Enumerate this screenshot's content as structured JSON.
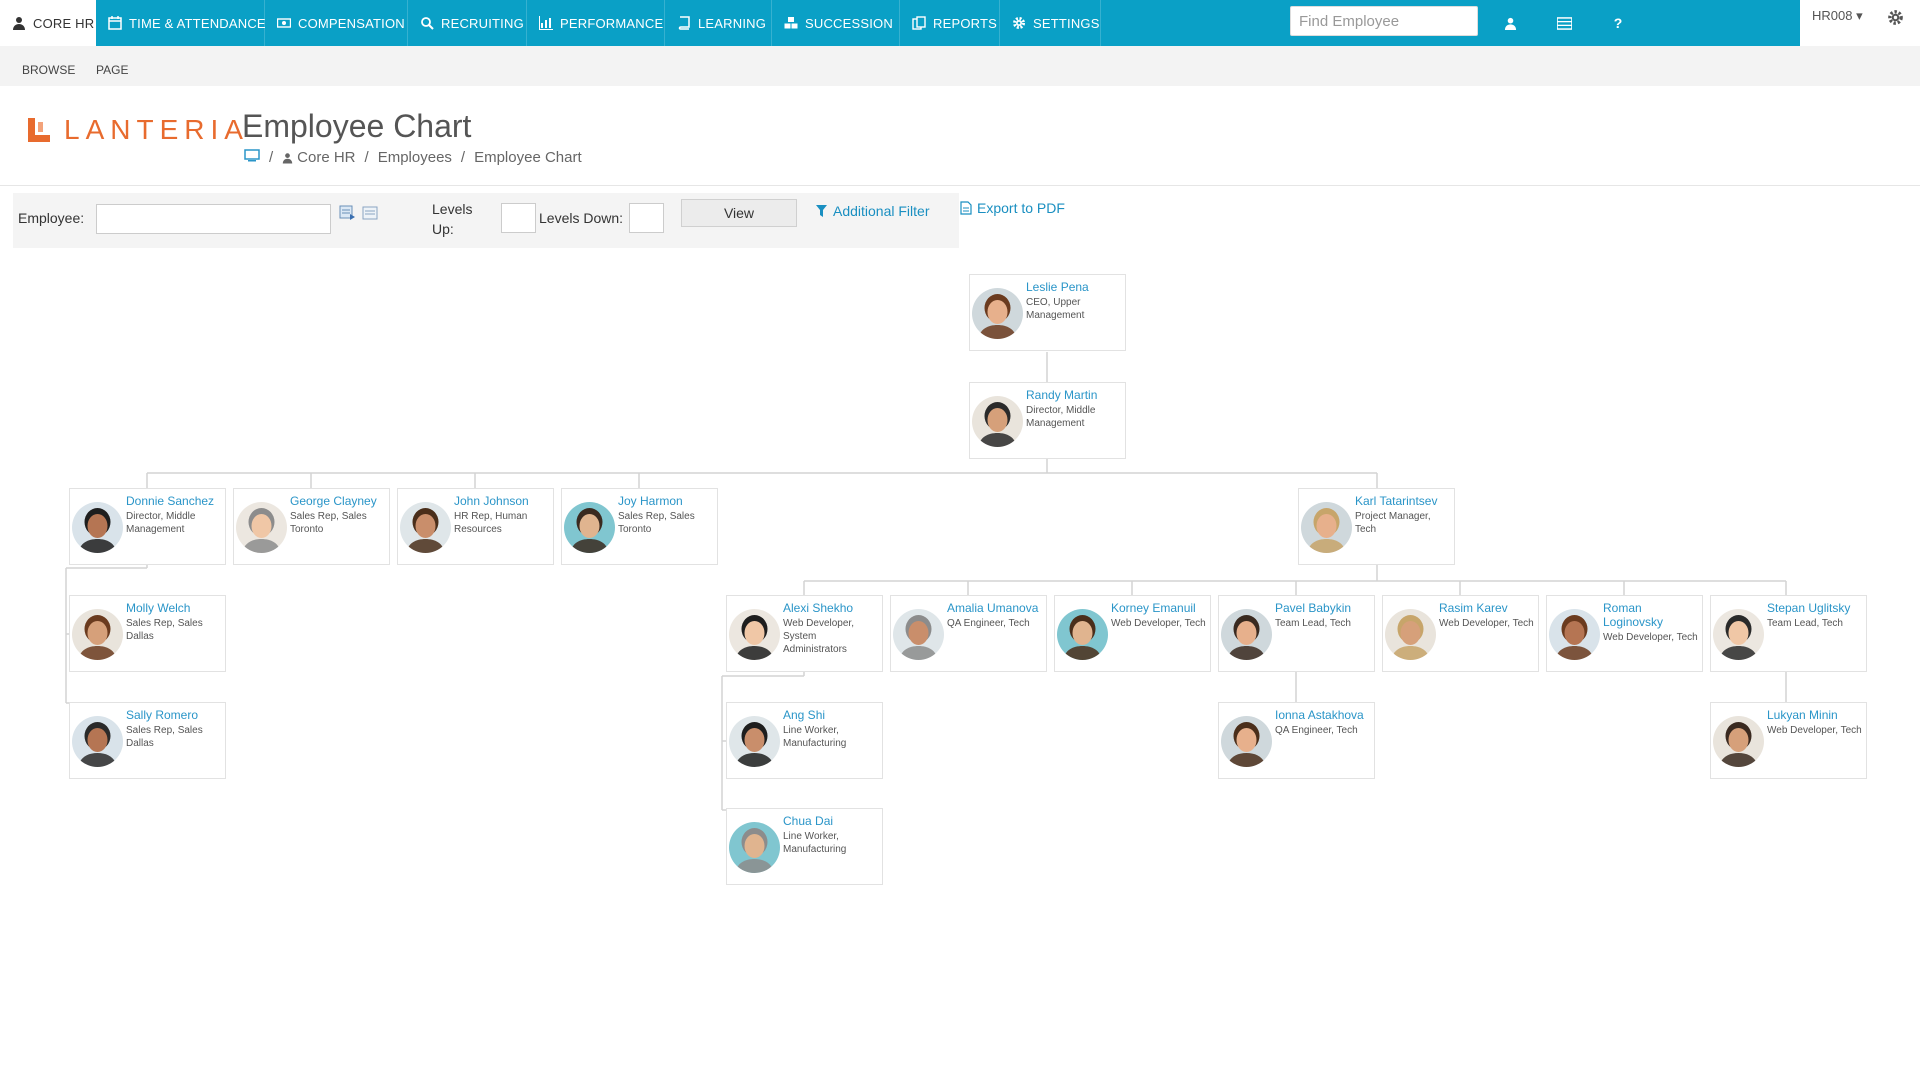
{
  "nav": {
    "items": [
      {
        "label": "CORE HR",
        "icon": "user-icon"
      },
      {
        "label": "TIME & ATTENDANCE",
        "icon": "calendar-icon"
      },
      {
        "label": "COMPENSATION",
        "icon": "money-icon"
      },
      {
        "label": "RECRUITING",
        "icon": "search-icon"
      },
      {
        "label": "PERFORMANCE",
        "icon": "bar-chart-icon"
      },
      {
        "label": "LEARNING",
        "icon": "book-icon"
      },
      {
        "label": "SUCCESSION",
        "icon": "cubes-icon"
      },
      {
        "label": "REPORTS",
        "icon": "copy-icon"
      },
      {
        "label": "SETTINGS",
        "icon": "gear-icon"
      }
    ],
    "search_placeholder": "Find Employee",
    "user_label": "HR008 ▾",
    "accent_color": "#0aa0c6"
  },
  "ribbon": {
    "tabs": [
      "BROWSE",
      "PAGE"
    ]
  },
  "header": {
    "logo_text": "LANTERIA",
    "page_title": "Employee Chart",
    "breadcrumb": [
      "Core HR",
      "Employees",
      "Employee Chart"
    ]
  },
  "filter": {
    "employee_label": "Employee:",
    "levels_up_label": "Levels Up:",
    "levels_down_label": "Levels Down:",
    "view_button": "View",
    "additional_filter": "Additional Filter",
    "export_pdf": "Export to PDF"
  },
  "employees": [
    {
      "name": "Leslie Pena",
      "title": "CEO, Upper Management",
      "manager": null
    },
    {
      "name": "Randy Martin",
      "title": "Director, Middle Management",
      "manager": "Leslie Pena"
    },
    {
      "name": "Donnie Sanchez",
      "title": "Director, Middle Management",
      "manager": "Randy Martin"
    },
    {
      "name": "George Clayney",
      "title": "Sales Rep, Sales Toronto",
      "manager": "Randy Martin"
    },
    {
      "name": "John Johnson",
      "title": "HR Rep, Human Resources",
      "manager": "Randy Martin"
    },
    {
      "name": "Joy Harmon",
      "title": "Sales Rep, Sales Toronto",
      "manager": "Randy Martin"
    },
    {
      "name": "Karl Tatarintsev",
      "title": "Project Manager, Tech",
      "manager": "Randy Martin"
    },
    {
      "name": "Molly Welch",
      "title": "Sales Rep, Sales Dallas",
      "manager": "Donnie Sanchez"
    },
    {
      "name": "Sally Romero",
      "title": "Sales Rep, Sales Dallas",
      "manager": "Donnie Sanchez"
    },
    {
      "name": "Alexi Shekho",
      "title": "Web Developer, System Administrators",
      "manager": "Karl Tatarintsev"
    },
    {
      "name": "Amalia Umanova",
      "title": "QA Engineer, Tech",
      "manager": "Karl Tatarintsev"
    },
    {
      "name": "Korney Emanuil",
      "title": "Web Developer, Tech",
      "manager": "Karl Tatarintsev"
    },
    {
      "name": "Pavel Babykin",
      "title": "Team Lead, Tech",
      "manager": "Karl Tatarintsev"
    },
    {
      "name": "Rasim Karev",
      "title": "Web Developer, Tech",
      "manager": "Karl Tatarintsev"
    },
    {
      "name": "Roman Loginovsky",
      "title": "Web Developer, Tech",
      "manager": "Karl Tatarintsev"
    },
    {
      "name": "Stepan Uglitsky",
      "title": "Team Lead, Tech",
      "manager": "Karl Tatarintsev"
    },
    {
      "name": "Ang Shi",
      "title": "Line Worker, Manufacturing",
      "manager": "Alexi Shekho"
    },
    {
      "name": "Chua Dai",
      "title": "Line Worker, Manufacturing",
      "manager": "Alexi Shekho"
    },
    {
      "name": "Ionna Astakhova",
      "title": "QA Engineer, Tech",
      "manager": "Pavel Babykin"
    },
    {
      "name": "Lukyan Minin",
      "title": "Web Developer, Tech",
      "manager": "Stepan Uglitsky"
    }
  ]
}
